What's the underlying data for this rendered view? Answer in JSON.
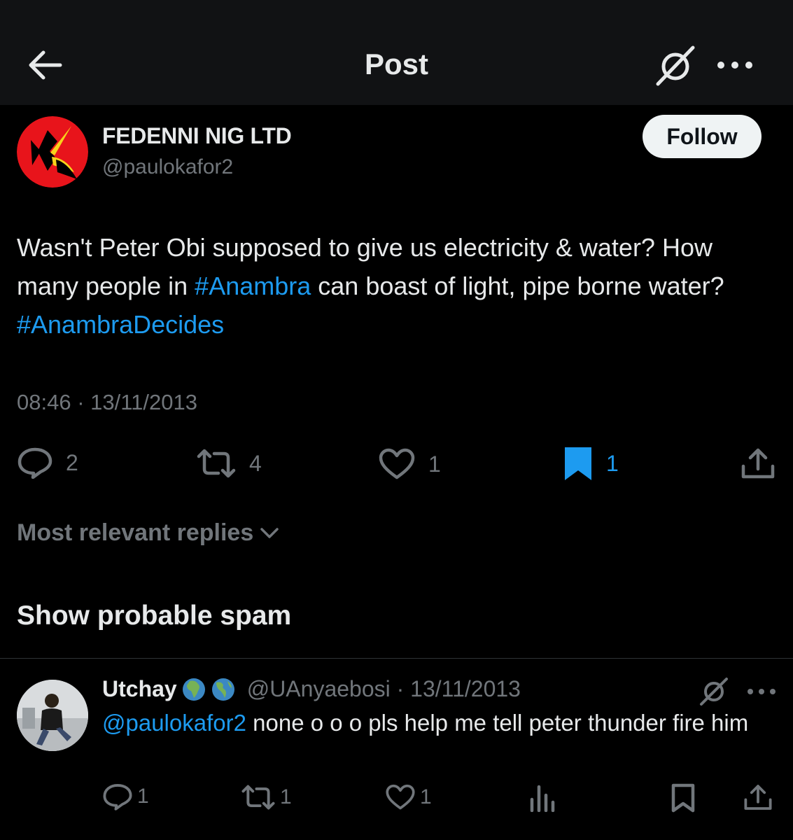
{
  "header": {
    "title": "Post",
    "back_icon": "arrow-left-icon",
    "grok_icon": "grok-slash-icon",
    "more_icon": "more-dots-icon"
  },
  "post": {
    "author_name": "FEDENNI NIG LTD",
    "author_handle": "@paulokafor2",
    "follow_label": "Follow",
    "text_part1": "Wasn't Peter Obi supposed to give us electricity & water? How many people in ",
    "hashtag1": "#Anambra",
    "text_part2": " can boast of light, pipe borne water? ",
    "hashtag2": "#AnambraDecides",
    "timestamp": "08:46 · 13/11/2013",
    "actions": {
      "replies": "2",
      "reposts": "4",
      "likes": "1",
      "bookmarks": "1"
    }
  },
  "replies_section": {
    "sort_label": "Most relevant replies",
    "spam_label": "Show probable spam"
  },
  "reply": {
    "author_name": "Utchay",
    "handle_date": "@UAnyaebosi · 13/11/2013",
    "mention": "@paulokafor2",
    "text": " none o o o pls help me tell peter thunder fire him",
    "actions": {
      "replies": "1",
      "reposts": "1",
      "likes": "1"
    }
  },
  "colors": {
    "background": "#000000",
    "topbar": "#111214",
    "text": "#e7e9ea",
    "secondary": "#71767b",
    "accent": "#1d9bf0",
    "follow_bg": "#eff3f4"
  }
}
